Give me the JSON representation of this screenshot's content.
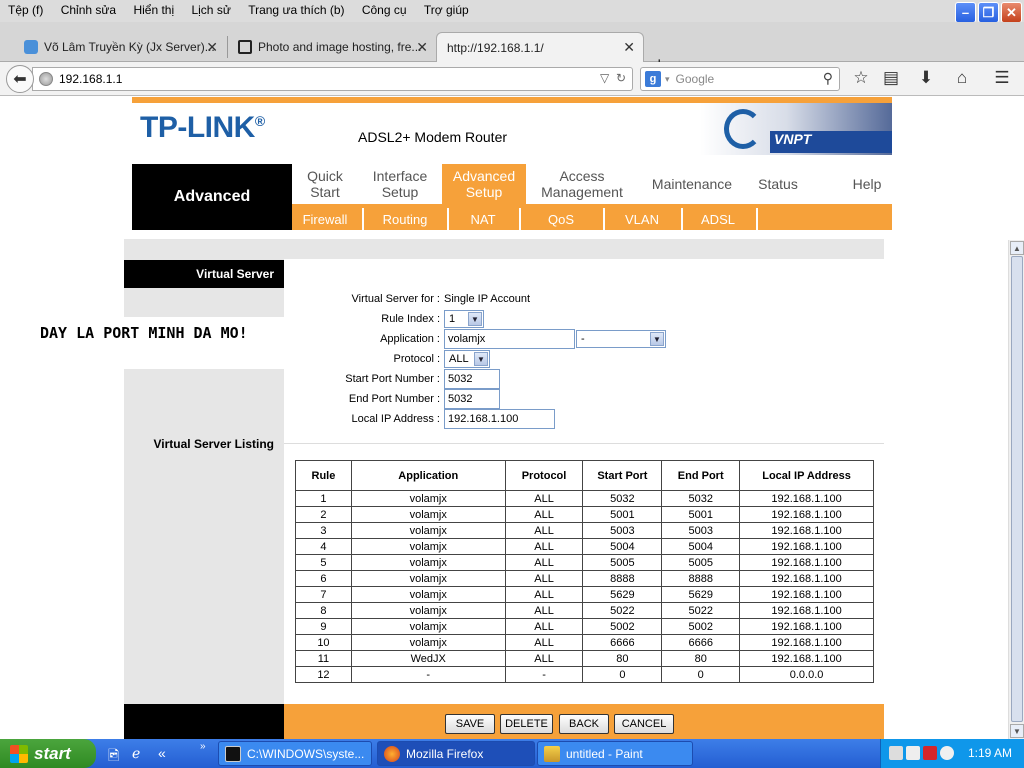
{
  "browser": {
    "menu": [
      "Tệp (f)",
      "Chỉnh sửa",
      "Hiển thị",
      "Lịch sử",
      "Trang ưa thích (b)",
      "Công cụ",
      "Trợ giúp"
    ],
    "tabs": [
      {
        "title": "Võ Lâm Truyền Kỳ (Jx Server)..."
      },
      {
        "title": "Photo and image hosting, fre..."
      },
      {
        "title": "http://192.168.1.1/"
      }
    ],
    "url": "192.168.1.1",
    "search_placeholder": "Google"
  },
  "router": {
    "brand": "TP-LINK",
    "brand_mark": "®",
    "model": "ADSL2+ Modem Router",
    "isp_logo": "VNPT",
    "section": "Advanced",
    "nav": [
      {
        "line1": "Quick",
        "line2": "Start"
      },
      {
        "line1": "Interface",
        "line2": "Setup"
      },
      {
        "line1": "Advanced",
        "line2": "Setup"
      },
      {
        "line1": "Access",
        "line2": "Management"
      },
      {
        "line1": "Maintenance",
        "line2": ""
      },
      {
        "line1": "Status",
        "line2": ""
      },
      {
        "line1": "Help",
        "line2": ""
      }
    ],
    "subnav": [
      "Firewall",
      "Routing",
      "NAT",
      "QoS",
      "VLAN",
      "ADSL"
    ],
    "sidebar_header": "Virtual Server",
    "annotation": "DAY LA PORT MINH DA MO!",
    "form": {
      "for_label": "Virtual Server for :",
      "for_value": "Single IP Account",
      "rule_index_label": "Rule Index :",
      "rule_index_value": "1",
      "application_label": "Application :",
      "application_value": "volamjx",
      "application_select": "-",
      "protocol_label": "Protocol :",
      "protocol_value": "ALL",
      "start_port_label": "Start Port Number :",
      "start_port_value": "5032",
      "end_port_label": "End Port Number :",
      "end_port_value": "5032",
      "local_ip_label": "Local IP Address :",
      "local_ip_value": "192.168.1.100"
    },
    "listing_label": "Virtual Server Listing",
    "table": {
      "headers": [
        "Rule",
        "Application",
        "Protocol",
        "Start Port",
        "End Port",
        "Local IP Address"
      ],
      "rows": [
        [
          "1",
          "volamjx",
          "ALL",
          "5032",
          "5032",
          "192.168.1.100"
        ],
        [
          "2",
          "volamjx",
          "ALL",
          "5001",
          "5001",
          "192.168.1.100"
        ],
        [
          "3",
          "volamjx",
          "ALL",
          "5003",
          "5003",
          "192.168.1.100"
        ],
        [
          "4",
          "volamjx",
          "ALL",
          "5004",
          "5004",
          "192.168.1.100"
        ],
        [
          "5",
          "volamjx",
          "ALL",
          "5005",
          "5005",
          "192.168.1.100"
        ],
        [
          "6",
          "volamjx",
          "ALL",
          "8888",
          "8888",
          "192.168.1.100"
        ],
        [
          "7",
          "volamjx",
          "ALL",
          "5629",
          "5629",
          "192.168.1.100"
        ],
        [
          "8",
          "volamjx",
          "ALL",
          "5022",
          "5022",
          "192.168.1.100"
        ],
        [
          "9",
          "volamjx",
          "ALL",
          "5002",
          "5002",
          "192.168.1.100"
        ],
        [
          "10",
          "volamjx",
          "ALL",
          "6666",
          "6666",
          "192.168.1.100"
        ],
        [
          "11",
          "WedJX",
          "ALL",
          "80",
          "80",
          "192.168.1.100"
        ],
        [
          "12",
          "-",
          "-",
          "0",
          "0",
          "0.0.0.0"
        ]
      ]
    },
    "buttons": [
      "SAVE",
      "DELETE",
      "BACK",
      "CANCEL"
    ]
  },
  "taskbar": {
    "start": "start",
    "items": [
      {
        "label": "C:\\WINDOWS\\syste..."
      },
      {
        "label": "Mozilla Firefox"
      },
      {
        "label": "untitled - Paint"
      }
    ],
    "clock": "1:19 AM"
  },
  "colors": {
    "accent_orange": "#f6a13a",
    "tplink_blue": "#1e5fa6",
    "xp_blue": "#245ed2"
  }
}
